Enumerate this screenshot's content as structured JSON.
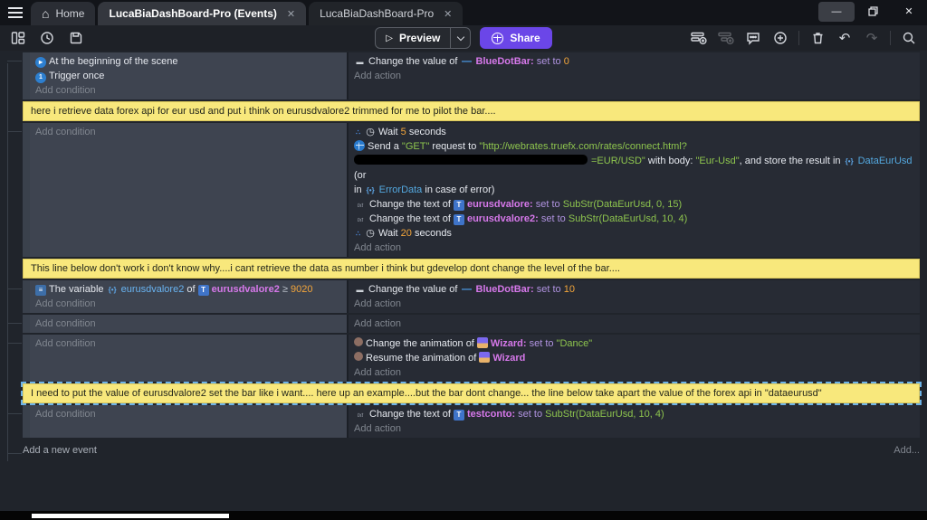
{
  "window": {
    "tabs": [
      {
        "label": "Home"
      },
      {
        "label": "LucaBiaDashBoard-Pro (Events)"
      },
      {
        "label": "LucaBiaDashBoard-Pro"
      }
    ],
    "close_glyph": "✕"
  },
  "toolbar": {
    "preview_label": "Preview",
    "share_label": "Share",
    "icons_left": [
      "project-manager-icon",
      "history-icon",
      "save-icon"
    ],
    "icons_right": [
      "add-event-icon",
      "add-subevent-icon",
      "add-comment-icon",
      "add-circle-icon",
      "delete-icon",
      "undo-icon",
      "redo-icon",
      "search-icon"
    ],
    "share_color": "#6b46e8"
  },
  "colors": {
    "comment_bg": "#f8e87c",
    "condition_bg": "#3e4450",
    "action_bg": "#272b34",
    "object_name": "#d678ea",
    "string_value": "#8ec54e",
    "number_value": "#f4a63b",
    "scene_variable": "#54a9e0"
  },
  "rows": [
    {
      "type": "event",
      "c": [
        {
          "runs": [
            {
              "i": "scene-start-icon"
            },
            {
              "t": "At the beginning of the scene"
            }
          ]
        },
        {
          "runs": [
            {
              "i": "trigger-once-icon"
            },
            {
              "t": "Trigger once"
            }
          ]
        },
        {
          "link": "Add condition"
        }
      ],
      "a": [
        {
          "runs": [
            {
              "i": "variable-value-icon"
            },
            {
              "t": "Change the value of "
            },
            {
              "i": "bluedotbar-icon"
            },
            {
              "t": "BlueDotBar:",
              "s": "obj"
            },
            {
              "t": " set to ",
              "s": "setto"
            },
            {
              "t": "0",
              "s": "num"
            }
          ]
        },
        {
          "link": "Add action"
        }
      ]
    },
    {
      "type": "comment",
      "text": "here i retrieve data forex api for eur usd and put i think on eurusdvalore2 trimmed for me to pilot the bar...."
    },
    {
      "type": "event",
      "c": [
        {
          "link": "Add condition"
        }
      ],
      "a": [
        {
          "runs": [
            {
              "i": "async-icon"
            },
            {
              "i": "clock-icon"
            },
            {
              "t": "Wait "
            },
            {
              "t": "5",
              "s": "num"
            },
            {
              "t": " seconds"
            }
          ]
        },
        {
          "wrap": true,
          "runs": [
            {
              "i": "globe-icon"
            },
            {
              "t": "Send a "
            },
            {
              "t": "\"GET\"",
              "s": "str"
            },
            {
              "t": " request to "
            },
            {
              "t": "\"http://webrates.truefx.com/rates/connect.html?",
              "s": "str"
            },
            {
              "br": true
            },
            {
              "i": "redaction-scribble"
            },
            {
              "t": "=EUR/USD\"",
              "s": "str"
            },
            {
              "t": " with body: "
            },
            {
              "t": "\"Eur-Usd\"",
              "s": "str"
            },
            {
              "t": ", and store the result in "
            },
            {
              "i": "struct-var-icon"
            },
            {
              "t": "DataEurUsd",
              "s": "gvar"
            },
            {
              "t": " (or"
            },
            {
              "br": true
            },
            {
              "t": "in "
            },
            {
              "i": "struct-var-icon"
            },
            {
              "t": "ErrorData",
              "s": "gvar"
            },
            {
              "t": " in case of error)"
            }
          ]
        },
        {
          "runs": [
            {
              "i": "text-action-icon"
            },
            {
              "t": "Change the text of "
            },
            {
              "i": "text-object-icon"
            },
            {
              "t": "eurusdvalore:",
              "s": "obj"
            },
            {
              "t": " set to ",
              "s": "setto"
            },
            {
              "t": "SubStr(DataEurUsd, 0, 15)",
              "s": "str"
            }
          ]
        },
        {
          "runs": [
            {
              "i": "text-action-icon"
            },
            {
              "t": "Change the text of "
            },
            {
              "i": "text-object-icon"
            },
            {
              "t": "eurusdvalore2:",
              "s": "obj"
            },
            {
              "t": " set to ",
              "s": "setto"
            },
            {
              "t": "SubStr(DataEurUsd, 10, 4)",
              "s": "str"
            }
          ]
        },
        {
          "runs": [
            {
              "i": "async-icon"
            },
            {
              "i": "clock-icon"
            },
            {
              "t": "Wait "
            },
            {
              "t": "20",
              "s": "num"
            },
            {
              "t": " seconds"
            }
          ]
        },
        {
          "link": "Add action"
        }
      ]
    },
    {
      "type": "comment",
      "text": "This line below don't work i don't know why....i cant retrieve the data as number i think but gdevelop dont change the level of the bar...."
    },
    {
      "type": "event",
      "c": [
        {
          "runs": [
            {
              "i": "variable-cond-icon"
            },
            {
              "t": "The variable "
            },
            {
              "i": "struct-var-icon"
            },
            {
              "t": "eurusdvalore2",
              "s": "bvar"
            },
            {
              "t": " of "
            },
            {
              "i": "text-object-icon"
            },
            {
              "t": "eurusdvalore2",
              "s": "obj"
            },
            {
              "t": " ≥ ",
              "s": "op"
            },
            {
              "t": "9020",
              "s": "num"
            }
          ]
        },
        {
          "link": "Add condition"
        }
      ],
      "a": [
        {
          "runs": [
            {
              "i": "variable-value-icon"
            },
            {
              "t": "Change the value of "
            },
            {
              "i": "bluedotbar-icon"
            },
            {
              "t": "BlueDotBar:",
              "s": "obj"
            },
            {
              "t": " set to ",
              "s": "setto"
            },
            {
              "t": "10",
              "s": "num"
            }
          ]
        },
        {
          "link": "Add action"
        }
      ]
    },
    {
      "type": "event",
      "c": [
        {
          "link": "Add condition"
        }
      ],
      "a": [
        {
          "link": "Add action"
        }
      ]
    },
    {
      "type": "event",
      "c": [
        {
          "link": "Add condition"
        }
      ],
      "a": [
        {
          "runs": [
            {
              "i": "animation-icon"
            },
            {
              "t": "Change the animation of "
            },
            {
              "i": "wizard-icon"
            },
            {
              "t": "Wizard:",
              "s": "obj"
            },
            {
              "t": " set to ",
              "s": "setto"
            },
            {
              "t": "\"Dance\"",
              "s": "str"
            }
          ]
        },
        {
          "runs": [
            {
              "i": "animation-icon"
            },
            {
              "t": "Resume the animation of "
            },
            {
              "i": "wizard-icon"
            },
            {
              "t": "Wizard",
              "s": "obj"
            }
          ]
        },
        {
          "link": "Add action"
        }
      ]
    },
    {
      "type": "comment",
      "selected": true,
      "text": "I need to put the value of eurusdvalore2 set the bar like i want.... here up an example....but the bar dont change... the line below take apart the value of the forex api in \"dataeurusd\""
    },
    {
      "type": "event",
      "c": [
        {
          "link": "Add condition"
        }
      ],
      "a": [
        {
          "runs": [
            {
              "i": "text-action-icon"
            },
            {
              "t": "Change the text of "
            },
            {
              "i": "text-object-icon"
            },
            {
              "t": "testconto:",
              "s": "obj"
            },
            {
              "t": " set to ",
              "s": "setto"
            },
            {
              "t": "SubStr(DataEurUsd, 10, 4)",
              "s": "str"
            }
          ]
        },
        {
          "link": "Add action"
        }
      ]
    }
  ],
  "footer": {
    "add_new_event": "Add a new event",
    "add_more": "Add..."
  }
}
